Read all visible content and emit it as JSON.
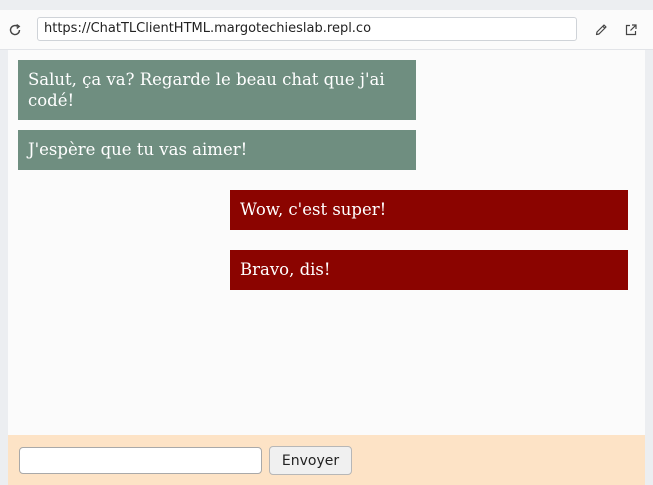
{
  "browser": {
    "url": "https://ChatTLClientHTML.margotechieslab.repl.co",
    "icons": {
      "reload": "reload-icon",
      "edit": "pencil-icon",
      "open_external": "open-external-icon"
    }
  },
  "chat": {
    "messages": [
      {
        "text": "Salut, ça va? Regarde le beau chat que j'ai codé!",
        "side": "left",
        "color": "#6f8e80"
      },
      {
        "text": "J'espère que tu vas aimer!",
        "side": "left",
        "color": "#6f8e80"
      },
      {
        "text": "Wow, c'est super!",
        "side": "right",
        "color": "#8b0400"
      },
      {
        "text": "Bravo, dis!",
        "side": "right",
        "color": "#8b0400"
      }
    ]
  },
  "composer": {
    "input_value": "",
    "input_placeholder": "",
    "send_label": "Envoyer",
    "background": "#fde3c6"
  }
}
